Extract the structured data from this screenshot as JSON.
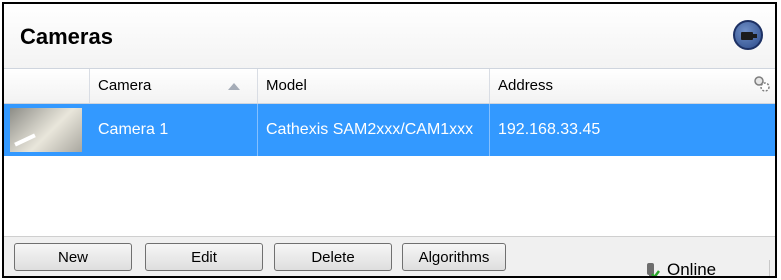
{
  "header": {
    "title": "Cameras"
  },
  "table": {
    "columns": [
      "",
      "Camera",
      "Model",
      "Address"
    ],
    "rows": [
      {
        "camera": "Camera 1",
        "model": "Cathexis SAM2xxx/CAM1xxx",
        "address": "192.168.33.45",
        "selected": true
      }
    ]
  },
  "buttons": {
    "new": "New",
    "edit": "Edit",
    "delete": "Delete",
    "algorithms": "Algorithms"
  },
  "status": {
    "text": "Online"
  },
  "colors": {
    "selection": "#3399ff",
    "accent": "#2b4a8a"
  }
}
